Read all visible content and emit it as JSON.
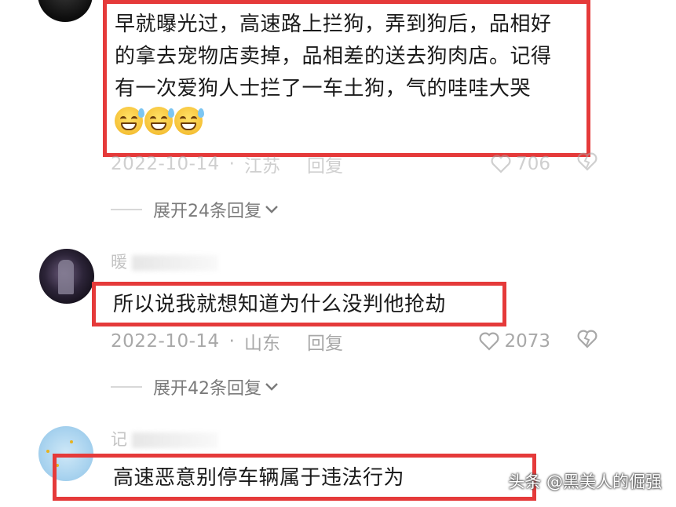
{
  "comments": [
    {
      "text_lines": [
        "早就曝光过，高速路上拦狗，弄到狗后，品相好",
        "的拿去宠物店卖掉，品相差的送去狗肉店。记得",
        "有一次爱狗人士拦了一车土狗，气的哇哇大哭"
      ],
      "emoji": [
        "laugh-sweat-emoji",
        "laugh-sweat-emoji",
        "laugh-sweat-emoji"
      ],
      "date": "2022-10-14",
      "location": "江苏",
      "reply_label": "回复",
      "likes": "706",
      "expand_label": "展开24条回复"
    },
    {
      "username": "暖",
      "text": "所以说我就想知道为什么没判他抢劫",
      "date": "2022-10-14",
      "location": "山东",
      "reply_label": "回复",
      "likes": "2073",
      "expand_label": "展开42条回复"
    },
    {
      "username": "记",
      "text": "高速恶意别停车辆属于违法行为"
    }
  ],
  "separator": "·",
  "watermark": "头条 @黑美人的倔强",
  "colors": {
    "highlight_border": "#e53a3a",
    "meta_text": "#a8a8a8",
    "body_text": "#1a1a1a"
  }
}
